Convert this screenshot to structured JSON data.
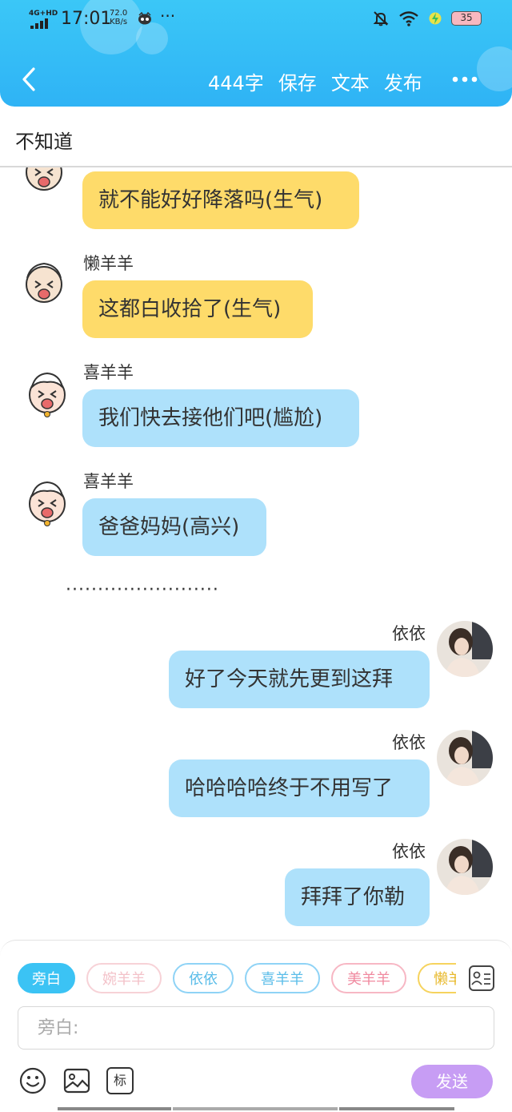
{
  "status_bar": {
    "network": "4G+HD",
    "time": "17:01",
    "speed_value": "72.0",
    "speed_unit": "KB/s",
    "more": "···",
    "battery": "35"
  },
  "toolbar": {
    "back_icon": "chevron-left-icon",
    "word_count": "444字",
    "save_label": "保存",
    "text_label": "文本",
    "publish_label": "发布",
    "more_icon": "ellipsis-horizontal-icon"
  },
  "topic": {
    "title": "不知道"
  },
  "messages": [
    {
      "sender": "",
      "text": "就不能好好降落吗(生气)",
      "side": "left",
      "color": "#fedb6a"
    },
    {
      "sender": "懒羊羊",
      "text": "这都白收拾了(生气)",
      "side": "left",
      "color": "#fedb6a"
    },
    {
      "sender": "喜羊羊",
      "text": "我们快去接他们吧(尴尬)",
      "side": "left",
      "color": "#aee1fb"
    },
    {
      "sender": "喜羊羊",
      "text": "爸爸妈妈(高兴)",
      "side": "left",
      "color": "#aee1fb"
    },
    {
      "sender": "依依",
      "text": "好了今天就先更到这拜",
      "side": "right",
      "color": "#aee1fb"
    },
    {
      "sender": "依依",
      "text": "哈哈哈哈终于不用写了",
      "side": "right",
      "color": "#aee1fb"
    },
    {
      "sender": "依依",
      "text": "拜拜了你勒",
      "side": "right",
      "color": "#aee1fb"
    }
  ],
  "separator": "························",
  "composer": {
    "roles": [
      {
        "label": "旁白",
        "selected": true,
        "color": "#3bc3f4"
      },
      {
        "label": "婉羊羊",
        "selected": false,
        "color": "#f7c9cf"
      },
      {
        "label": "依依",
        "selected": false,
        "color": "#8fd3f6"
      },
      {
        "label": "喜羊羊",
        "selected": false,
        "color": "#8fd3f6"
      },
      {
        "label": "美羊羊",
        "selected": false,
        "color": "#f7b7c4"
      },
      {
        "label": "懒羊",
        "selected": false,
        "color": "#f6d35e"
      }
    ],
    "role_manager_icon": "contact-card-icon",
    "input_placeholder": "旁白:",
    "tools": [
      "smiley-icon",
      "image-icon",
      "tag-icon"
    ],
    "tag_label": "标",
    "send_label": "发送"
  }
}
